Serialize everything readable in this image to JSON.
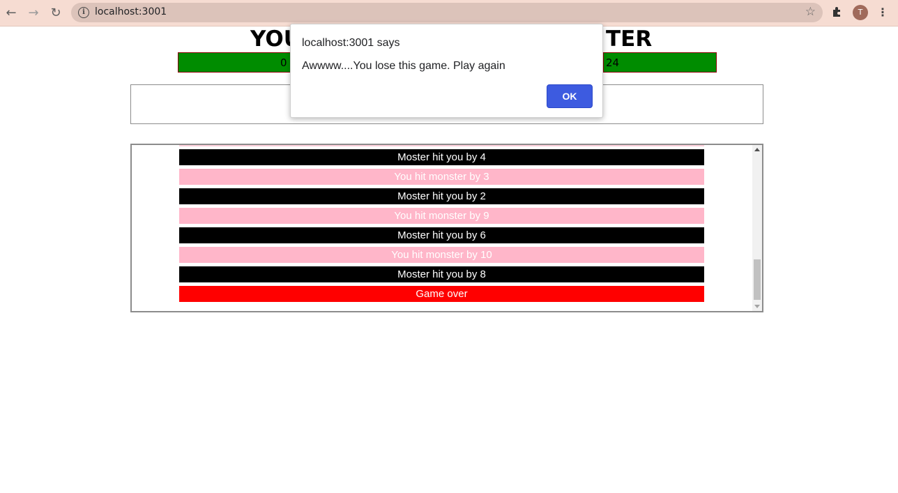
{
  "browser": {
    "url": "localhost:3001",
    "avatar_letter": "T"
  },
  "page": {
    "title_left": "YOU",
    "title_right": "TER",
    "player_health": "0",
    "monster_health": "24"
  },
  "log": {
    "entries": [
      {
        "text": "Moster hit you by 4",
        "type": "monster"
      },
      {
        "text": "You hit monster by 3",
        "type": "player"
      },
      {
        "text": "Moster hit you by 2",
        "type": "monster"
      },
      {
        "text": "You hit monster by 9",
        "type": "player"
      },
      {
        "text": "Moster hit you by 6",
        "type": "monster"
      },
      {
        "text": "You hit monster by 10",
        "type": "player"
      },
      {
        "text": "Moster hit you by 8",
        "type": "monster"
      },
      {
        "text": "Game over",
        "type": "over"
      }
    ]
  },
  "dialog": {
    "header": "localhost:3001 says",
    "message": "Awwww....You lose this game. Play again",
    "ok_label": "OK"
  },
  "colors": {
    "health_bar": "#008c00",
    "monster_row": "#000000",
    "player_row": "#ffb6c9",
    "game_over_row": "#ff0000",
    "ok_button": "#3d5be0"
  }
}
